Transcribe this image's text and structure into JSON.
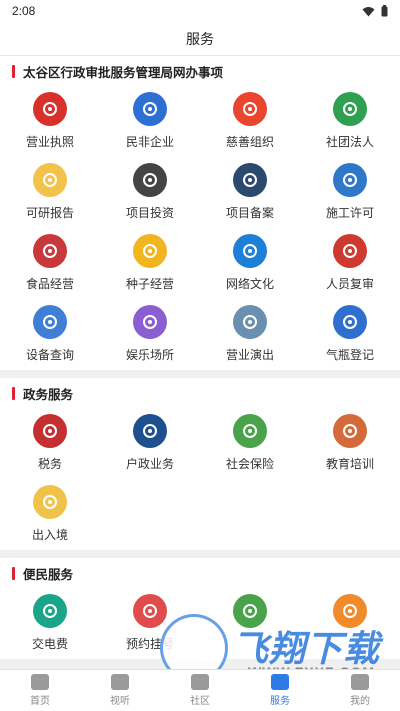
{
  "status": {
    "time": "2:08"
  },
  "header": {
    "title": "服务"
  },
  "sections": [
    {
      "title": "太谷区行政审批服务管理局网办事项",
      "items": [
        {
          "label": "营业执照",
          "icon": "emblem-icon",
          "color": "#d8302a"
        },
        {
          "label": "民非企业",
          "icon": "org-badge-icon",
          "color": "#2d6fd3"
        },
        {
          "label": "慈善组织",
          "icon": "heart-icon",
          "color": "#e9452f"
        },
        {
          "label": "社团法人",
          "icon": "knot-icon",
          "color": "#2fa052"
        },
        {
          "label": "可研报告",
          "icon": "report-icon",
          "color": "#f3c24a"
        },
        {
          "label": "项目投资",
          "icon": "investment-icon",
          "color": "#444444"
        },
        {
          "label": "项目备案",
          "icon": "record-icon",
          "color": "#2c4a6e"
        },
        {
          "label": "施工许可",
          "icon": "construction-icon",
          "color": "#2f78c8"
        },
        {
          "label": "食品经营",
          "icon": "food-icon",
          "color": "#c8393b"
        },
        {
          "label": "种子经营",
          "icon": "seed-icon",
          "color": "#f1b61f"
        },
        {
          "label": "网络文化",
          "icon": "ie-icon",
          "color": "#1e7fd6"
        },
        {
          "label": "人员复审",
          "icon": "person-icon",
          "color": "#cf3a2f"
        },
        {
          "label": "设备查询",
          "icon": "clipboard-icon",
          "color": "#3f7fd8"
        },
        {
          "label": "娱乐场所",
          "icon": "disc-icon",
          "color": "#8a5fd1"
        },
        {
          "label": "营业演出",
          "icon": "stage-icon",
          "color": "#6a8fb0"
        },
        {
          "label": "气瓶登记",
          "icon": "cylinder-icon",
          "color": "#2f6fd0"
        }
      ]
    },
    {
      "title": "政务服务",
      "items": [
        {
          "label": "税务",
          "icon": "tax-icon",
          "color": "#c42f2f"
        },
        {
          "label": "户政业务",
          "icon": "police-icon",
          "color": "#1e4f8f"
        },
        {
          "label": "社会保险",
          "icon": "insurance-icon",
          "color": "#4aa34a"
        },
        {
          "label": "教育培训",
          "icon": "education-icon",
          "color": "#d46a3a"
        },
        {
          "label": "出入境",
          "icon": "plane-icon",
          "color": "#f0c24a"
        }
      ]
    },
    {
      "title": "便民服务",
      "items": [
        {
          "label": "交电费",
          "icon": "electricity-icon",
          "color": "#1aa58a"
        },
        {
          "label": "预约挂号",
          "icon": "appointment-icon",
          "color": "#e04b4b"
        },
        {
          "label": "",
          "icon": "ticket-icon",
          "color": "#49a34b"
        },
        {
          "label": "",
          "icon": "service-icon",
          "color": "#f08a2a"
        }
      ]
    }
  ],
  "tabs": [
    {
      "label": "首页",
      "icon": "home-icon"
    },
    {
      "label": "视听",
      "icon": "video-icon"
    },
    {
      "label": "社区",
      "icon": "community-icon"
    },
    {
      "label": "服务",
      "icon": "service-tab-icon",
      "active": true
    },
    {
      "label": "我的",
      "icon": "profile-icon"
    }
  ],
  "watermark": {
    "text": "飞翔下载",
    "url": "WWW.FXXZ.COM"
  },
  "colors": {
    "accent": "#2f7be5",
    "section_bar": "#dd2233"
  }
}
